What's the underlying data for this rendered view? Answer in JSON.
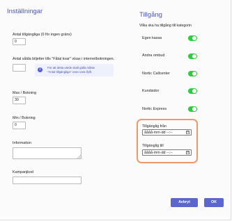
{
  "left": {
    "title": "Inställningar",
    "available_count": {
      "label": "Antal tillgängliga (0 för ingen gräns)",
      "value": "0"
    },
    "few_left": {
      "label": "Antal sålda biljetter tills \"Fåtal kvar\" visas i internetbokningen.",
      "value": ""
    },
    "info": {
      "icon": "i",
      "line1": "För att detta värde skall gälla måste",
      "line2": "\"Antal tillgängliga\" ovan vara ifyllt."
    },
    "max_per_booking": {
      "label": "Max / Bokning",
      "value": "30"
    },
    "min_per_booking": {
      "label": "Min / Bokning",
      "value": "0"
    },
    "information": {
      "label": "Information",
      "value": ""
    },
    "campaign_code": {
      "label": "Kampanjkod",
      "value": ""
    }
  },
  "right": {
    "title": "Tillgång",
    "subtitle": "Vilka ska ha tillgång till kategorin",
    "categories": [
      {
        "label": "Egen kassa",
        "on": true
      },
      {
        "label": "Andra ombud",
        "on": true
      },
      {
        "label": "Nortic Callcenter",
        "on": true
      },
      {
        "label": "Kundsidor",
        "on": true
      },
      {
        "label": "Nortic Express",
        "on": true
      }
    ],
    "available_from": {
      "label": "Tillgänglig från",
      "value": "åååå-mm-dd --:--"
    },
    "available_to": {
      "label": "Tillgänglig till",
      "value": "åååå-mm-dd --:--"
    }
  },
  "buttons": {
    "cancel": "Avbryt",
    "ok": "OK"
  },
  "colors": {
    "accent": "#5b67cc",
    "toggle_on": "#2ecc40",
    "highlight": "#f0986a"
  }
}
